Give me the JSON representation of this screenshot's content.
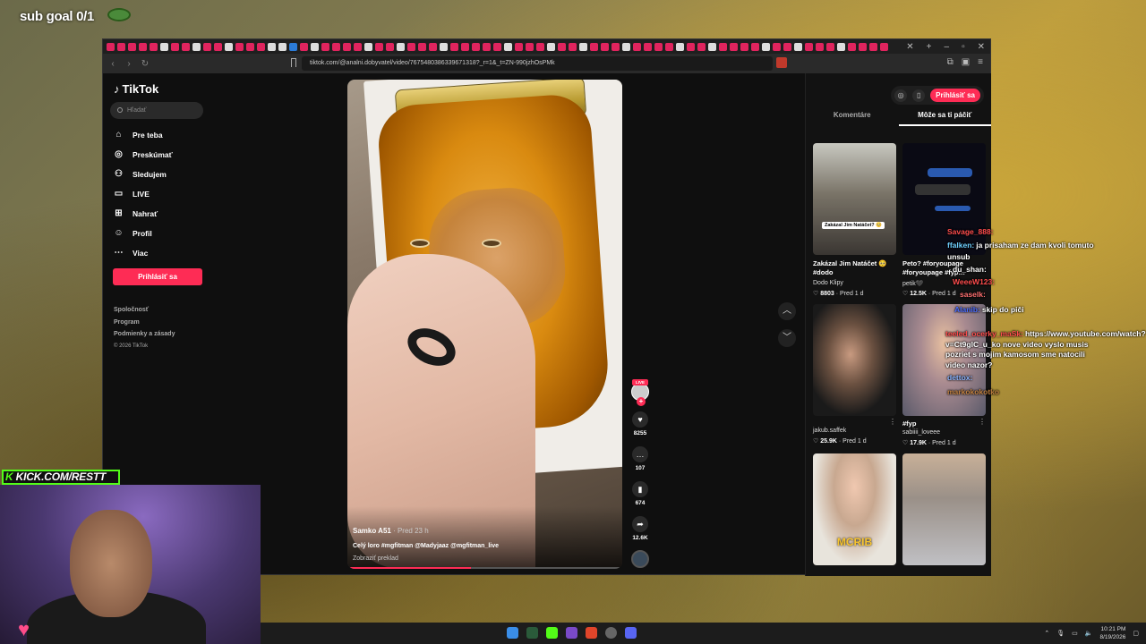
{
  "overlay": {
    "sub_goal": "sub goal 0/1",
    "kick_label": "KICK.COM/RESTT"
  },
  "browser": {
    "url": "tiktok.com/@analni.dobyvatel/video/7675480386339671318?_r=1&_t=ZN-990jzhOsPMk"
  },
  "tiktok": {
    "logo": "TikTok",
    "search_placeholder": "Hľadať",
    "nav": [
      {
        "label": "Pre teba",
        "icon": "home-icon"
      },
      {
        "label": "Preskúmať",
        "icon": "compass-icon"
      },
      {
        "label": "Sledujem",
        "icon": "following-icon"
      },
      {
        "label": "LIVE",
        "icon": "live-icon"
      },
      {
        "label": "Nahrať",
        "icon": "upload-icon"
      },
      {
        "label": "Profil",
        "icon": "profile-icon"
      },
      {
        "label": "Viac",
        "icon": "more-icon"
      }
    ],
    "login_button": "Prihlásiť sa",
    "footer": [
      "Spoločnosť",
      "Program",
      "Podmienky a zásady"
    ],
    "copyright": "© 2026 TikTok",
    "video": {
      "author": "Samko A51",
      "time": "· Pred 23 h",
      "caption": "Celý loro #mgfitman @Madyjaaz @mgfitman_live",
      "translate": "Zobraziť preklad",
      "progress": 0.45
    },
    "actions": {
      "live": "LIVE",
      "likes": "8255",
      "comments": "107",
      "saves": "674",
      "shares": "12.6K"
    },
    "right_panel": {
      "login": "Prihlásiť sa",
      "tabs": [
        "Komentáre",
        "Môže sa ti páčiť"
      ],
      "videos": [
        {
          "title": "Zakázal Jim Natáčet 🥺 #dodo",
          "author": "Dodo Klipy",
          "likes": "8803",
          "time": "Pred 1 d",
          "overlay": "Zakázal Jim Natáčet? 🥺"
        },
        {
          "title": "Peto? #foryoupage #foryoupage #fyp…",
          "author": "petik🖤",
          "likes": "12.5K",
          "time": "Pred 1 d"
        },
        {
          "title": "",
          "author": "jakub.saffek",
          "likes": "25.9K",
          "time": "Pred 1 d"
        },
        {
          "title": "#fyp",
          "author": "sabiiii_loveee",
          "likes": "17.9K",
          "time": "Pred 1 d"
        },
        {
          "title": "",
          "overlay": "MCRIB"
        },
        {
          "title": ""
        }
      ]
    }
  },
  "chat": [
    {
      "user": "Savage_888:",
      "text": "",
      "color": "#ff4d4d"
    },
    {
      "user": "ffalken:",
      "text": "ja prisaham ze dam kvoli tomuto unsub",
      "color": "#6fd0ff"
    },
    {
      "user": "du_shan:",
      "text": "",
      "color": "#ffffff"
    },
    {
      "user": "WeeeW123:",
      "text": "",
      "color": "#ff4d4d"
    },
    {
      "user": "saselk:",
      "text": "",
      "color": "#ff7070"
    },
    {
      "user": "Alanib:",
      "text": "skip do piči",
      "color": "#4d6dff"
    },
    {
      "user": "teeled_ocerky_maSk:",
      "text": "https://www.youtube.com/watch?v=Ct9glC_u_ko nove video vyslo musis pozriet s mojim kamosom sme natocili video nazor?",
      "color": "#ff4d4d"
    },
    {
      "user": "dettox:",
      "text": "",
      "color": "#8ab4ff"
    },
    {
      "user": "markokokotko",
      "text": "",
      "color": "#c08040"
    }
  ],
  "taskbar": {
    "time": "10:21 PM",
    "date": "8/19/2026"
  }
}
